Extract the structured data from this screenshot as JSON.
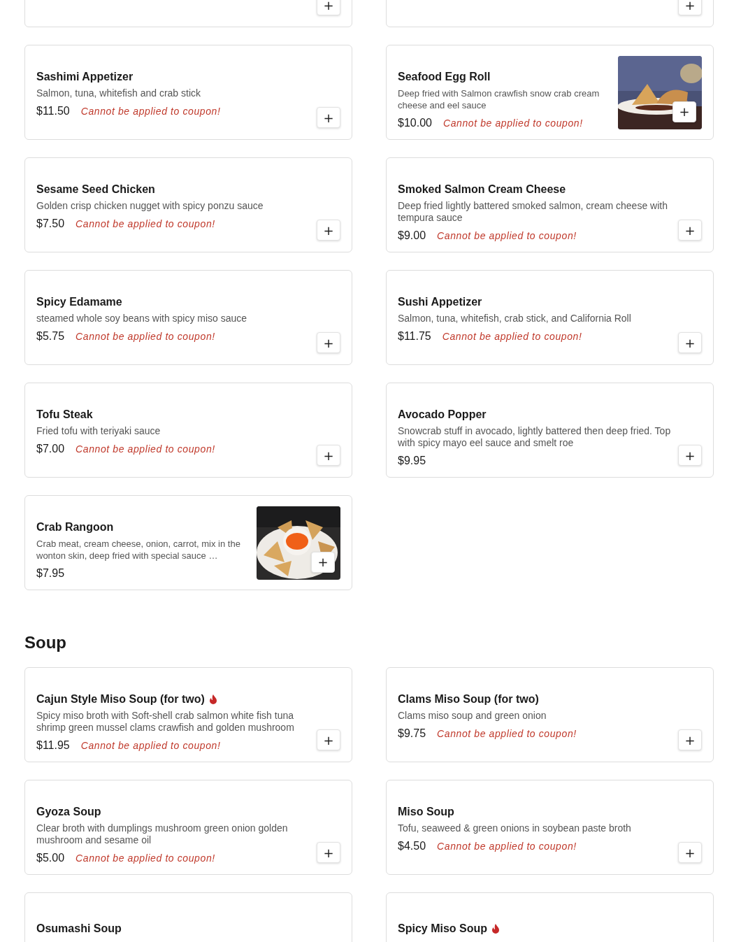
{
  "sections": [
    {
      "cut_off_cards": [
        {
          "add": "+"
        },
        {
          "add": "+"
        }
      ],
      "items": [
        {
          "kind": "plain",
          "name": "Sashimi Appetizer",
          "spicy": false,
          "description": "Salmon, tuna, whitefish and crab stick",
          "price": "$11.50",
          "coupon_note": "Cannot be applied to coupon!",
          "add": "+"
        },
        {
          "name": "Seafood Egg Roll",
          "spicy": false,
          "description": "Deep fried with Salmon crawfish snow crab cream cheese and eel sauce",
          "price": "$10.00",
          "coupon_note": "Cannot be applied to coupon!",
          "add": "+"
        },
        {
          "kind": "plain",
          "name": "Sesame Seed Chicken",
          "spicy": false,
          "description": "Golden crisp chicken nugget with spicy ponzu sauce",
          "price": "$7.50",
          "coupon_note": "Cannot be applied to coupon!",
          "add": "+"
        },
        {
          "kind": "plain",
          "name": "Smoked Salmon Cream Cheese",
          "spicy": false,
          "description": "Deep fried lightly battered smoked salmon, cream cheese with tempura sauce",
          "price": "$9.00",
          "coupon_note": "Cannot be applied to coupon!",
          "add": "+"
        },
        {
          "kind": "plain",
          "name": "Spicy Edamame",
          "spicy": false,
          "description": "steamed whole soy beans with spicy miso sauce",
          "price": "$5.75",
          "coupon_note": "Cannot be applied to coupon!",
          "add": "+"
        },
        {
          "kind": "plain",
          "name": "Sushi Appetizer",
          "spicy": false,
          "description": "Salmon, tuna, whitefish, crab stick, and California Roll",
          "price": "$11.75",
          "coupon_note": "Cannot be applied to coupon!",
          "add": "+"
        },
        {
          "kind": "plain",
          "name": "Tofu Steak",
          "spicy": false,
          "description": "Fried tofu with teriyaki sauce",
          "price": "$7.00",
          "coupon_note": "Cannot be applied to coupon!",
          "add": "+"
        },
        {
          "kind": "plain",
          "name": "Avocado Popper",
          "spicy": false,
          "description": "Snowcrab stuff in avocado, lightly battered then deep fried. Top with spicy mayo eel sauce and smelt roe",
          "price": "$9.95",
          "add": "+"
        },
        {
          "name": "Crab Rangoon",
          "spicy": false,
          "description": "Crab meat, cream cheese, onion, carrot, mix in the wonton skin, deep fried with special sauce …",
          "price": "$7.95",
          "add": "+"
        }
      ]
    },
    {
      "heading": "Soup",
      "items": [
        {
          "kind": "plain",
          "name": "Cajun Style Miso Soup (for two)",
          "spicy": true,
          "description": "Spicy miso broth with Soft-shell crab salmon white fish tuna shrimp green mussel clams crawfish and golden mushroom",
          "price": "$11.95",
          "coupon_note": "Cannot be applied to coupon!",
          "add": "+"
        },
        {
          "kind": "plain",
          "name": "Clams Miso Soup (for two)",
          "spicy": false,
          "description": "Clams miso soup and green onion",
          "price": "$9.75",
          "coupon_note": "Cannot be applied to coupon!",
          "add": "+"
        },
        {
          "kind": "plain",
          "name": "Gyoza Soup",
          "spicy": false,
          "description": "Clear broth with dumplings mushroom green onion golden mushroom and sesame oil",
          "price": "$5.00",
          "coupon_note": "Cannot be applied to coupon!",
          "add": "+"
        },
        {
          "kind": "plain",
          "name": "Miso Soup",
          "spicy": false,
          "description": "Tofu, seaweed & green onions in soybean paste broth",
          "price": "$4.50",
          "coupon_note": "Cannot be applied to coupon!",
          "add": "+"
        },
        {
          "kind": "cut",
          "name": "Osumashi Soup",
          "spicy": false
        },
        {
          "kind": "cut",
          "name": "Spicy Miso Soup",
          "spicy": true
        }
      ]
    }
  ]
}
